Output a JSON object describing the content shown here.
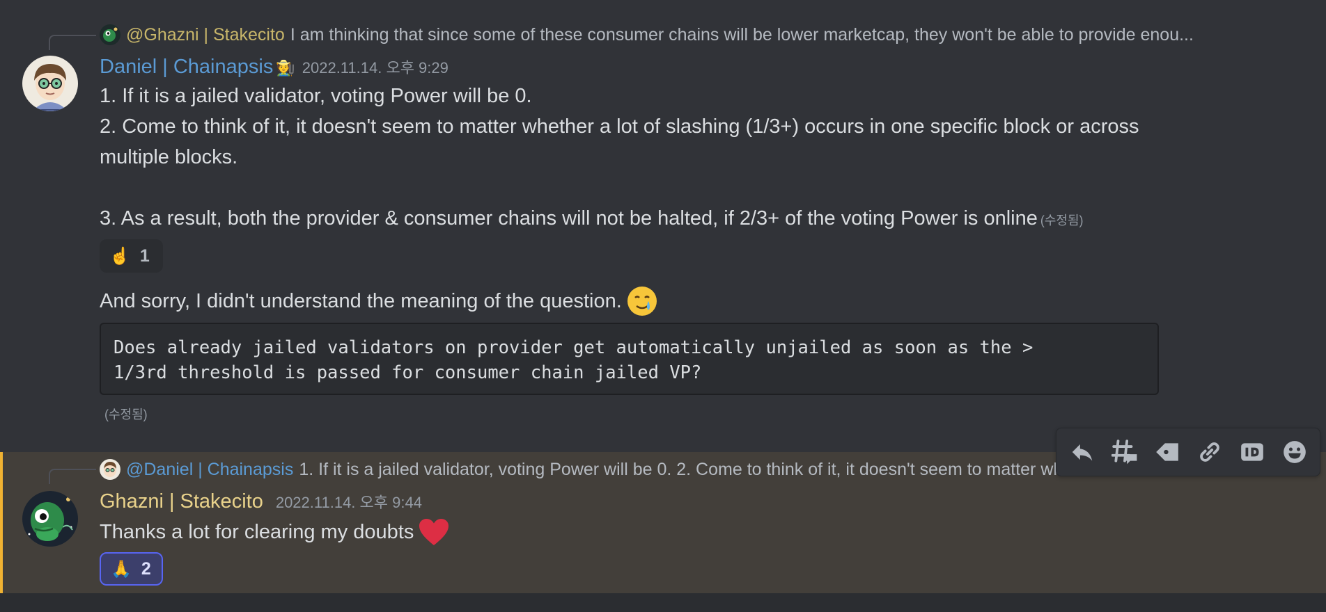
{
  "colors": {
    "background": "#313338",
    "highlight_background": "#433f3a",
    "highlight_bar": "#f0b232",
    "daniel_name": "#5b9bd5",
    "ghazni_name": "#e9d28b",
    "mention_ghazni": "#c8b66a",
    "mention_daniel": "#5b9bd5",
    "heart": "#dd2e44"
  },
  "message1": {
    "reply": {
      "mention": "@Ghazni | Stakecito",
      "text": "I am thinking that since some of these consumer chains will be lower marketcap, they won't be able to provide enou..."
    },
    "author": "Daniel | Chainapsis",
    "author_badges": "🧑‍🌾",
    "timestamp": "2022.11.14. 오후 9:29",
    "lines": [
      "1. If it is a jailed validator, voting Power will be 0.",
      "2. Come to think of it, it doesn't seem to matter whether a lot of slashing (1/3+) occurs in one specific block or across",
      "multiple blocks.",
      "3. As a result, both the provider & consumer chains will not be halted, if 2/3+ of the voting Power is online"
    ],
    "edited_label": "(수정됨)",
    "reaction": {
      "emoji": "☝️",
      "count": "1"
    },
    "followup_text": "And sorry, I didn't understand the meaning of the question.",
    "followup_emoji": "🥲",
    "code": "Does already jailed validators on provider get automatically unjailed as soon as the >\n1/3rd threshold is passed for consumer chain jailed VP?",
    "followup_edited_label": "(수정됨)"
  },
  "message2": {
    "reply": {
      "mention": "@Daniel | Chainapsis",
      "text": "1. If it is a jailed validator, voting Power will be 0. 2. Come to think of it, it doesn't seem to matter whether a lot of sla..."
    },
    "author": "Ghazni | Stakecito",
    "timestamp": "2022.11.14. 오후 9:44",
    "text": "Thanks a lot for clearing my doubts",
    "emoji": "❤️",
    "reaction": {
      "emoji": "🙏",
      "count": "2"
    }
  },
  "toolbar": {
    "icons": [
      "reply-icon",
      "create-thread-icon",
      "tag-icon",
      "copy-link-icon",
      "copy-id-icon",
      "add-reaction-icon"
    ]
  }
}
